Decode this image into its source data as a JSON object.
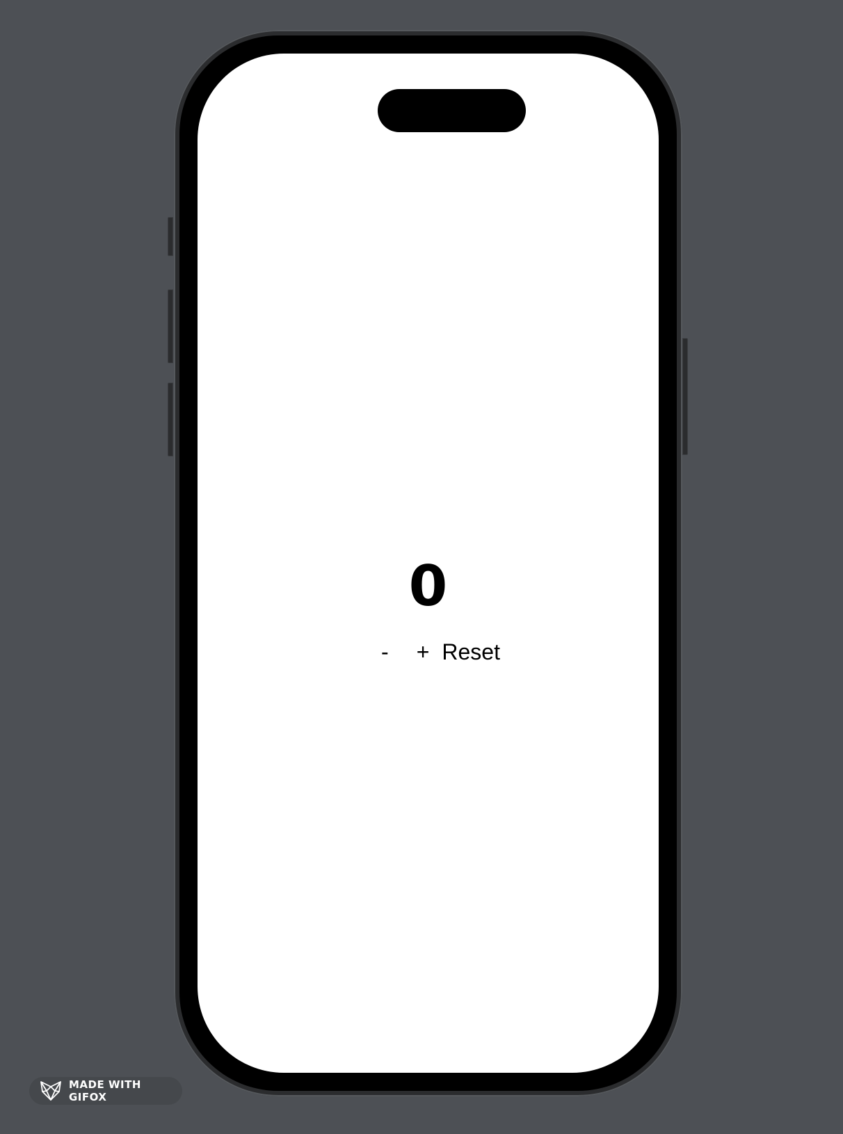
{
  "counter": {
    "value": "0"
  },
  "controls": {
    "decrement_label": "-",
    "increment_label": "+",
    "reset_label": "Reset"
  },
  "watermark": {
    "text": "MADE WITH GIFOX",
    "icon": "fox-logo-icon"
  },
  "colors": {
    "backdrop": "#4d5055",
    "screen": "#ffffff",
    "text": "#000000"
  }
}
